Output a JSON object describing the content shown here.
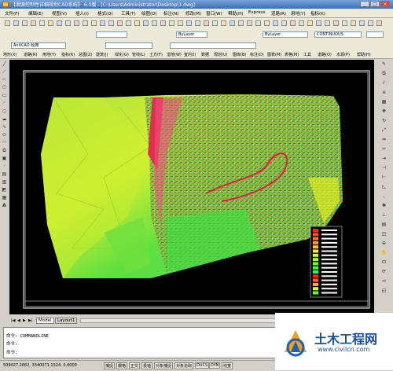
{
  "window": {
    "title": "【湘源控制性详细规划CAD系统】 6.0版 - [C:\\Users\\Administrator\\Desktop\\1.dwg]"
  },
  "menus": [
    "文件(F)",
    "编辑(E)",
    "视图(V)",
    "插入(I)",
    "格式(O)",
    "工具(T)",
    "绘图(D)",
    "标注(N)",
    "修改(M)",
    "窗口(W)",
    "帮助(H)",
    "Express",
    "道路(R)",
    "用地(Y)",
    "指标(K)"
  ],
  "toolbar": {
    "text_style": "AntiCAD 经典",
    "layer_combo": "ByLayer",
    "linetype_combo": "CONTINUOUS",
    "color_combo": "ByLayer"
  },
  "menus2": [
    "地形(X)",
    "道路(R)",
    "用地(Y)",
    "指标(K)",
    "总图(Z)",
    "建筑(J)",
    "绿化(G)",
    "管线(L)",
    "土方(F)",
    "湿地(W)",
    "室内(I)",
    "数据",
    "规划(U)",
    "图库(B)",
    "标注(D)",
    "图表(M)",
    "表格(M)",
    "工具",
    "道路(O)",
    "水源(P)",
    "帮助(H)"
  ],
  "legend": {
    "colors": [
      "#ff2020",
      "#ff5020",
      "#ff7a20",
      "#ffa020",
      "#ffc820",
      "#fff020",
      "#d8ff20",
      "#a8ff20",
      "#70ff20",
      "#40ff30",
      "#20ff60",
      "#ff2020",
      "#ff6020",
      "#ffb020",
      "#e0ff20",
      "#60ff20"
    ]
  },
  "layout_tabs": [
    "Model",
    "Layout1"
  ],
  "command": {
    "line1": "命令: COMMANDLINE",
    "line2": "命令:",
    "line3": "命令:"
  },
  "status": {
    "coords": "509027.2662, 3340071.1524, 0.0000",
    "buttons": [
      "捕捉",
      "栅格",
      "正交",
      "极轴",
      "对象捕捉",
      "对象追踪",
      "DUCS",
      "DYN",
      "线宽"
    ]
  },
  "watermark": {
    "brand": "土木工程网",
    "url": "www.civilcn.com"
  }
}
